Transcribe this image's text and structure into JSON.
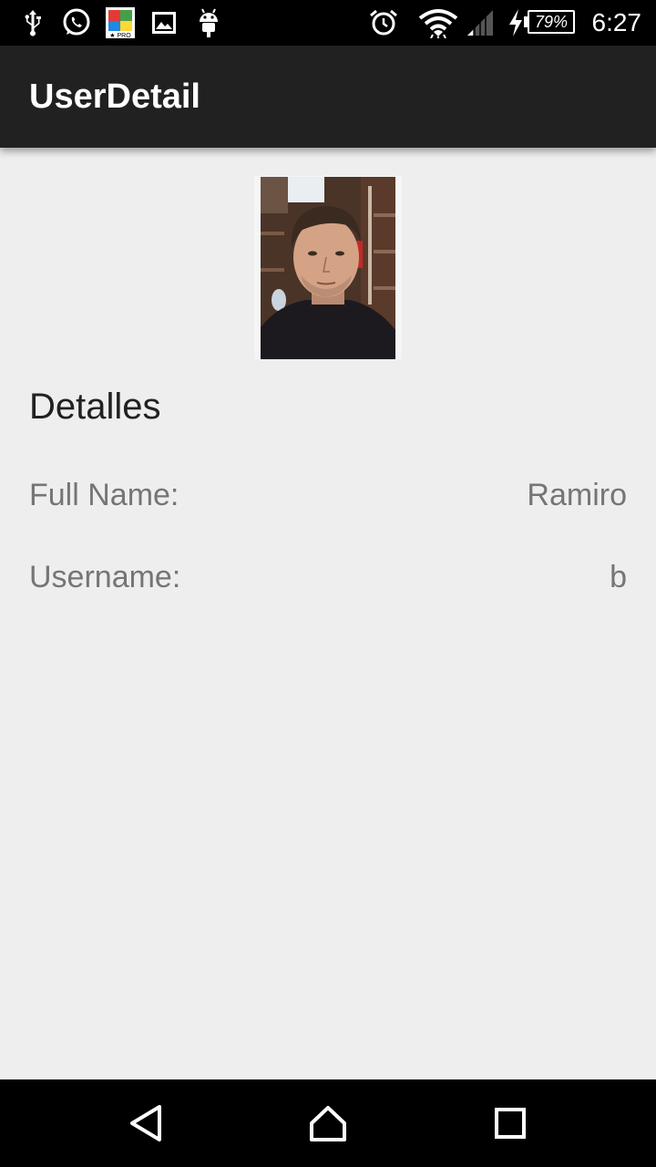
{
  "status_bar": {
    "time": "6:27",
    "battery_percent": "79%",
    "icons": [
      "usb-icon",
      "whatsapp-icon",
      "pro-app-icon",
      "image-icon",
      "android-icon",
      "alarm-icon",
      "wifi-icon",
      "signal-icon",
      "charging-icon",
      "battery-icon"
    ]
  },
  "app_bar": {
    "title": "UserDetail"
  },
  "user": {
    "photo_icon": "user-photo",
    "section_title": "Detalles",
    "fields": [
      {
        "label": "Full Name:",
        "value": "Ramiro"
      },
      {
        "label": "Username:",
        "value": "b"
      }
    ]
  },
  "nav_bar": {
    "icons": [
      "back-icon",
      "home-icon",
      "recents-icon"
    ]
  },
  "colors": {
    "status_bar": "#000000",
    "app_bar": "#212121",
    "background": "#eeeeee",
    "title_text": "#ffffff",
    "label_text": "#757575",
    "section_text": "#212121"
  }
}
